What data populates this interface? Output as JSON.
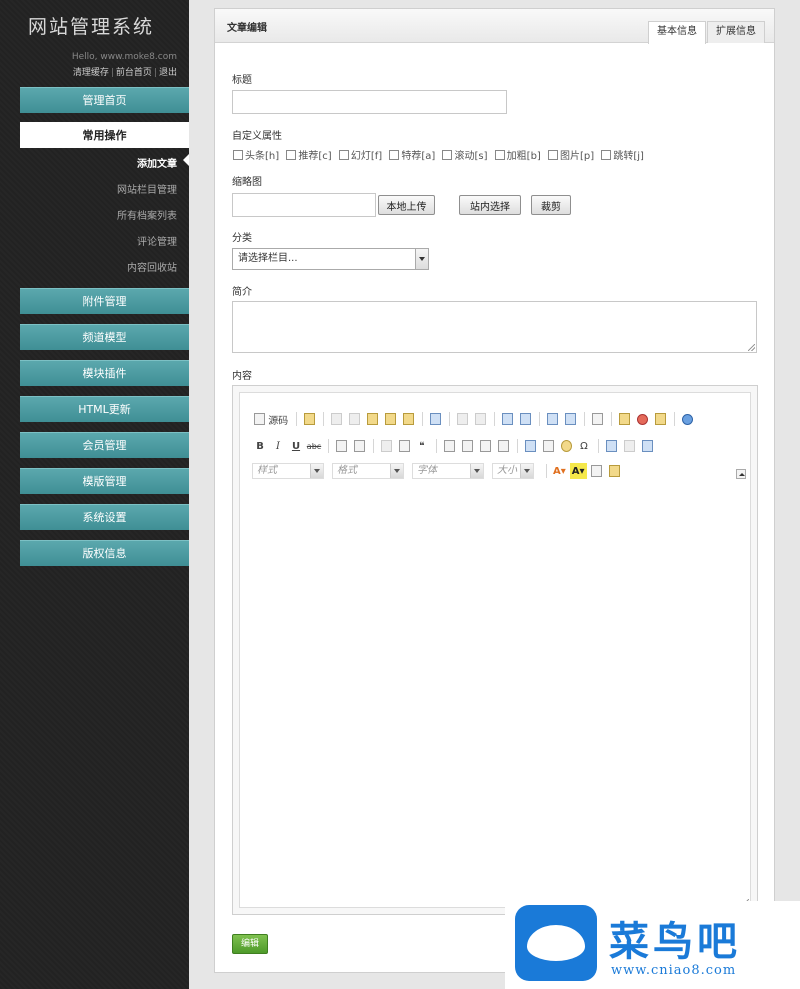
{
  "sidebar": {
    "site_title": "网站管理系统",
    "hello": "Hello, www.moke8.com",
    "links": [
      "清理缓存",
      "前台首页",
      "退出"
    ],
    "nav": [
      "管理首页",
      "常用操作",
      "附件管理",
      "频道模型",
      "模块插件",
      "HTML更新",
      "会员管理",
      "模版管理",
      "系统设置",
      "版权信息"
    ],
    "sub_items": [
      "添加文章",
      "网站栏目管理",
      "所有档案列表",
      "评论管理",
      "内容回收站"
    ]
  },
  "panel": {
    "title": "文章编辑",
    "tabs": [
      "基本信息",
      "扩展信息"
    ]
  },
  "form": {
    "title_label": "标题",
    "attrs_label": "自定义属性",
    "attrs": [
      "头条[h]",
      "推荐[c]",
      "幻灯[f]",
      "特荐[a]",
      "滚动[s]",
      "加粗[b]",
      "图片[p]",
      "跳转[j]"
    ],
    "thumb_label": "缩略图",
    "upload_button": "本地上传",
    "site_select_button": "站内选择",
    "crop_button": "裁剪",
    "category_label": "分类",
    "category_placeholder": "请选择栏目...",
    "summary_label": "简介",
    "content_label": "内容",
    "submit_button": "编辑"
  },
  "editor": {
    "source_label": "源码",
    "bold": "B",
    "italic": "I",
    "underline": "U",
    "strike": "abc",
    "omega": "Ω",
    "quote": "❝",
    "font_color": "A",
    "bg_color": "A",
    "combos": [
      "样式",
      "格式",
      "字体",
      "大小"
    ]
  },
  "watermark": {
    "name": "菜鸟吧",
    "url": "www.cniao8.com"
  },
  "colors": {
    "nav_teal": "#4a9aa0",
    "submit_green": "#5faa36",
    "watermark_blue": "#1a7ad8"
  }
}
